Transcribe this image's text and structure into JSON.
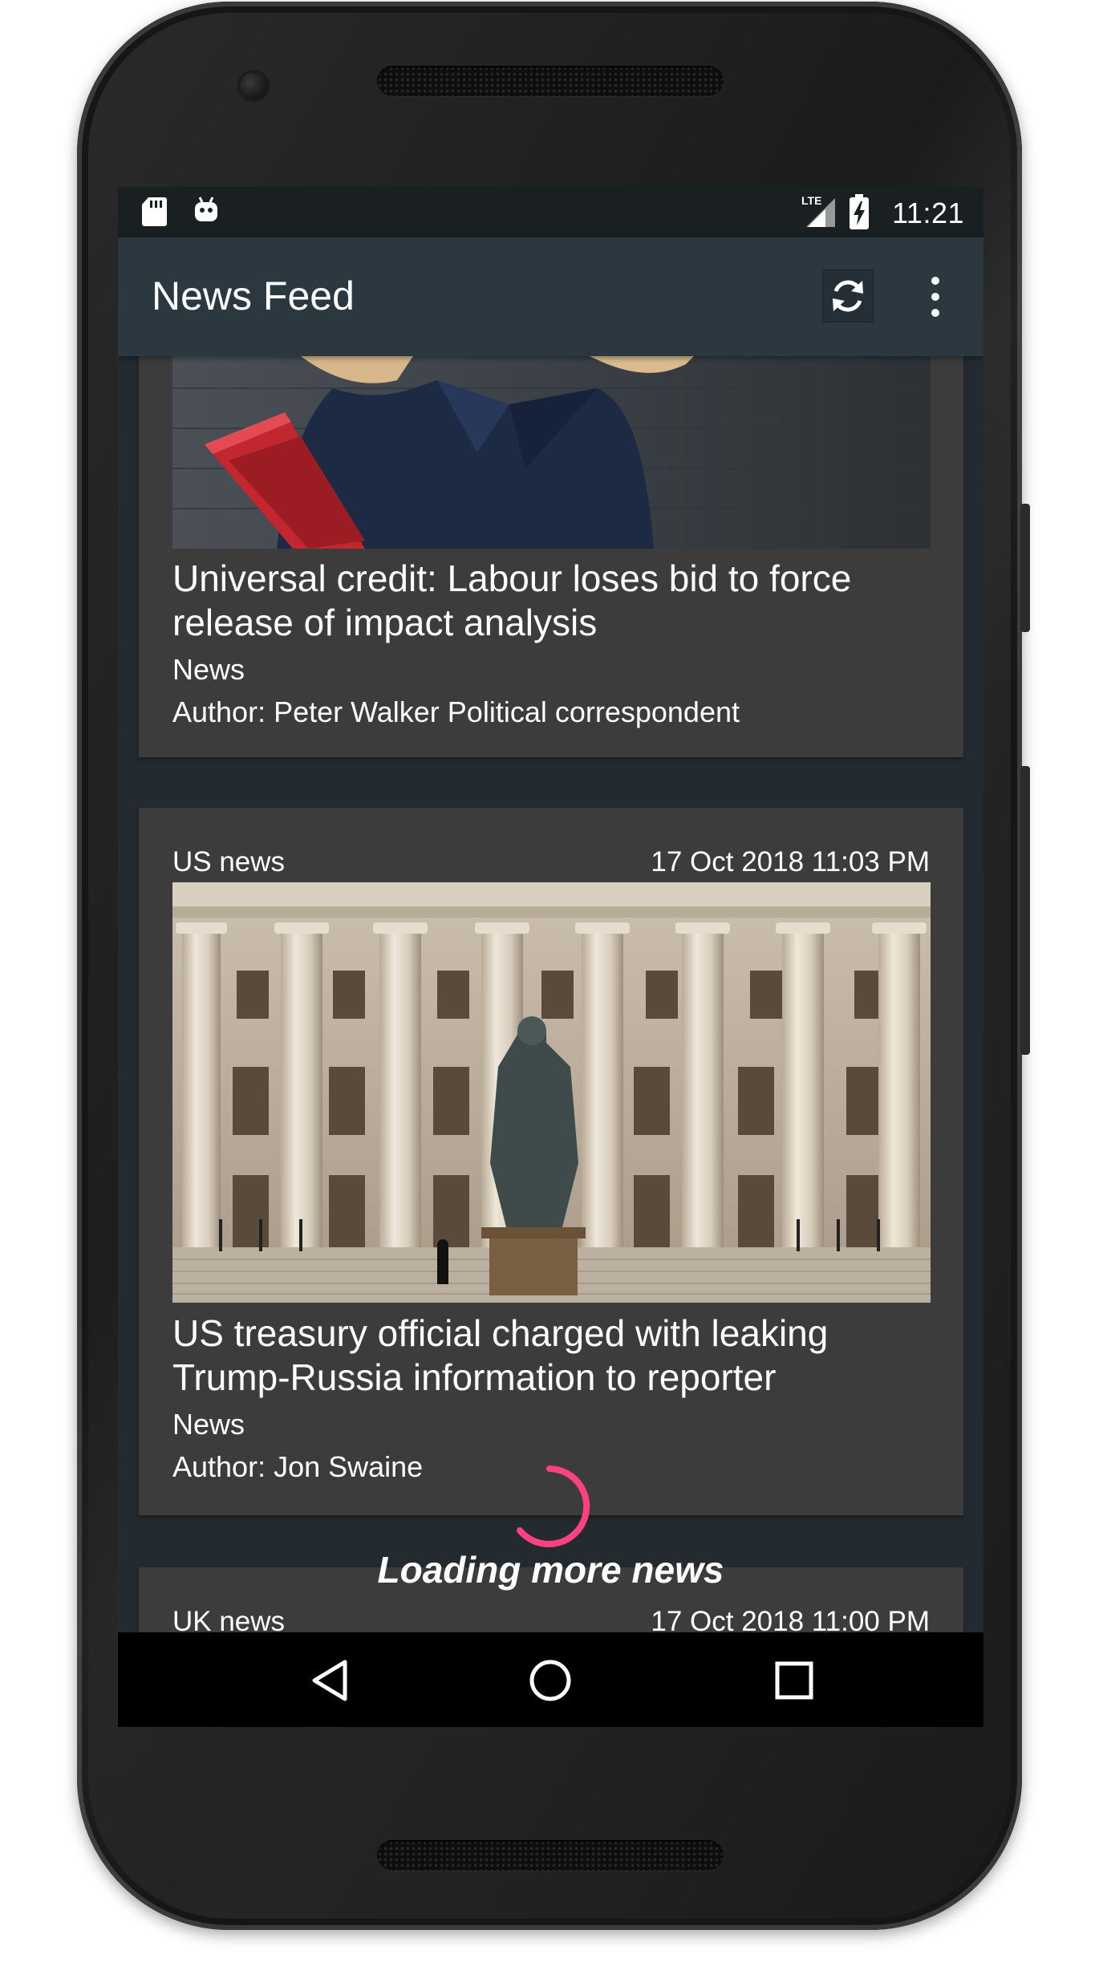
{
  "status_bar": {
    "time": "11:21",
    "network": "LTE",
    "icons": [
      "sd-card-icon",
      "android-debug-icon",
      "lte-signal-icon",
      "battery-charging-icon"
    ]
  },
  "app_bar": {
    "title": "News Feed",
    "actions": [
      "refresh-icon",
      "overflow-menu-icon"
    ]
  },
  "feed": {
    "articles": [
      {
        "title": "Universal credit: Labour loses bid to force release of impact analysis",
        "section": "News",
        "author": "Author: Peter Walker Political correspondent"
      },
      {
        "category": "US news",
        "date": "17 Oct 2018 11:03 PM",
        "title": "US treasury official charged with leaking Trump-Russia information to reporter",
        "section": "News",
        "author": "Author: Jon Swaine"
      },
      {
        "category": "UK news",
        "date": "17 Oct 2018 11:00 PM"
      }
    ]
  },
  "loading": {
    "text": "Loading more news",
    "spinner_color": "#ff4081"
  },
  "nav_bar": {
    "buttons": [
      "back-icon",
      "home-icon",
      "recents-icon"
    ]
  },
  "colors": {
    "app_bar": "#2b3840",
    "background": "#232b30",
    "card": "#3c3c3c",
    "accent": "#ff4081"
  }
}
